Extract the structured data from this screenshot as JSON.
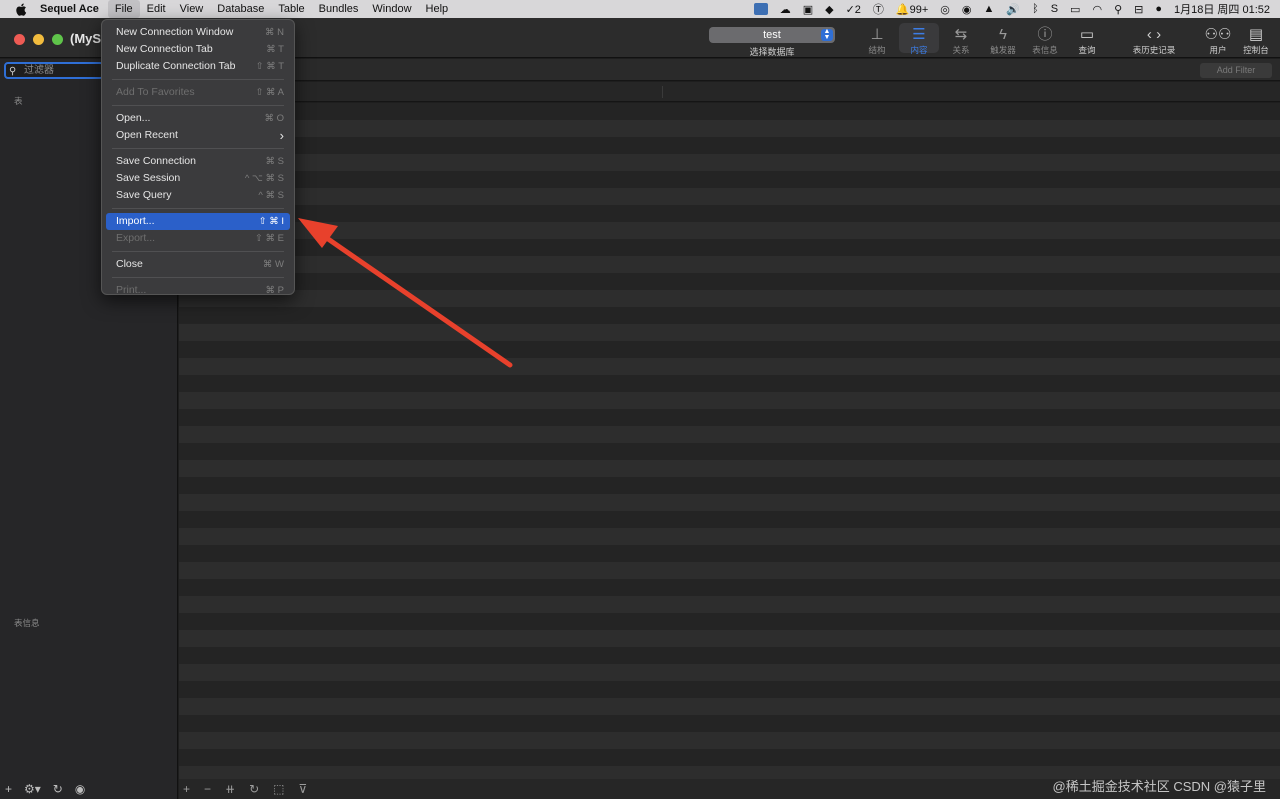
{
  "menubar": {
    "app_name": "Sequel Ace",
    "items": [
      "File",
      "Edit",
      "View",
      "Database",
      "Table",
      "Bundles",
      "Window",
      "Help"
    ],
    "active_item": "File",
    "status": {
      "badge_count": "2",
      "notifications": "99+",
      "datetime": "1月18日 周四 01:52"
    }
  },
  "window": {
    "title": "(MySQ",
    "database_select": {
      "value": "test",
      "label": "选择数据库"
    },
    "toolbar": [
      {
        "label": "结构",
        "icon": "structure-icon"
      },
      {
        "label": "内容",
        "icon": "content-icon"
      },
      {
        "label": "关系",
        "icon": "relations-icon"
      },
      {
        "label": "触发器",
        "icon": "triggers-icon"
      },
      {
        "label": "表信息",
        "icon": "table-info-icon"
      },
      {
        "label": "查询",
        "icon": "query-icon"
      },
      {
        "label": "表历史记录",
        "icon": "history-icon"
      },
      {
        "label": "用户",
        "icon": "users-icon"
      },
      {
        "label": "控制台",
        "icon": "console-icon"
      }
    ]
  },
  "sidebar": {
    "filter_placeholder": "过滤器",
    "tables_label": "表",
    "table_info_label": "表信息"
  },
  "content": {
    "add_filter_label": "Add Filter"
  },
  "file_menu": {
    "items": [
      {
        "label": "New Connection Window",
        "shortcut": "⌘ N",
        "enabled": true
      },
      {
        "label": "New Connection Tab",
        "shortcut": "⌘ T",
        "enabled": true
      },
      {
        "label": "Duplicate Connection Tab",
        "shortcut": "⇧ ⌘ T",
        "enabled": true
      },
      {
        "label": "Add To Favorites",
        "shortcut": "⇧ ⌘ A",
        "enabled": false
      },
      {
        "label": "Open...",
        "shortcut": "⌘ O",
        "enabled": true
      },
      {
        "label": "Open Recent",
        "shortcut": "›",
        "enabled": true
      },
      {
        "label": "Save Connection",
        "shortcut": "⌘ S",
        "enabled": true
      },
      {
        "label": "Save Session",
        "shortcut": "^ ⌥ ⌘ S",
        "enabled": true
      },
      {
        "label": "Save Query",
        "shortcut": "^ ⌘ S",
        "enabled": true
      },
      {
        "label": "Import...",
        "shortcut": "⇧ ⌘ I",
        "enabled": true,
        "highlighted": true
      },
      {
        "label": "Export...",
        "shortcut": "⇧ ⌘ E",
        "enabled": false
      },
      {
        "label": "Close",
        "shortcut": "⌘ W",
        "enabled": true
      },
      {
        "label": "Print...",
        "shortcut": "⌘ P",
        "enabled": false
      }
    ]
  },
  "watermark": "@稀土掘金技术社区 CSDN @猿子里",
  "colors": {
    "highlight": "#2b60c9",
    "arrow": "#e8412c",
    "accent": "#2f6fd6"
  }
}
